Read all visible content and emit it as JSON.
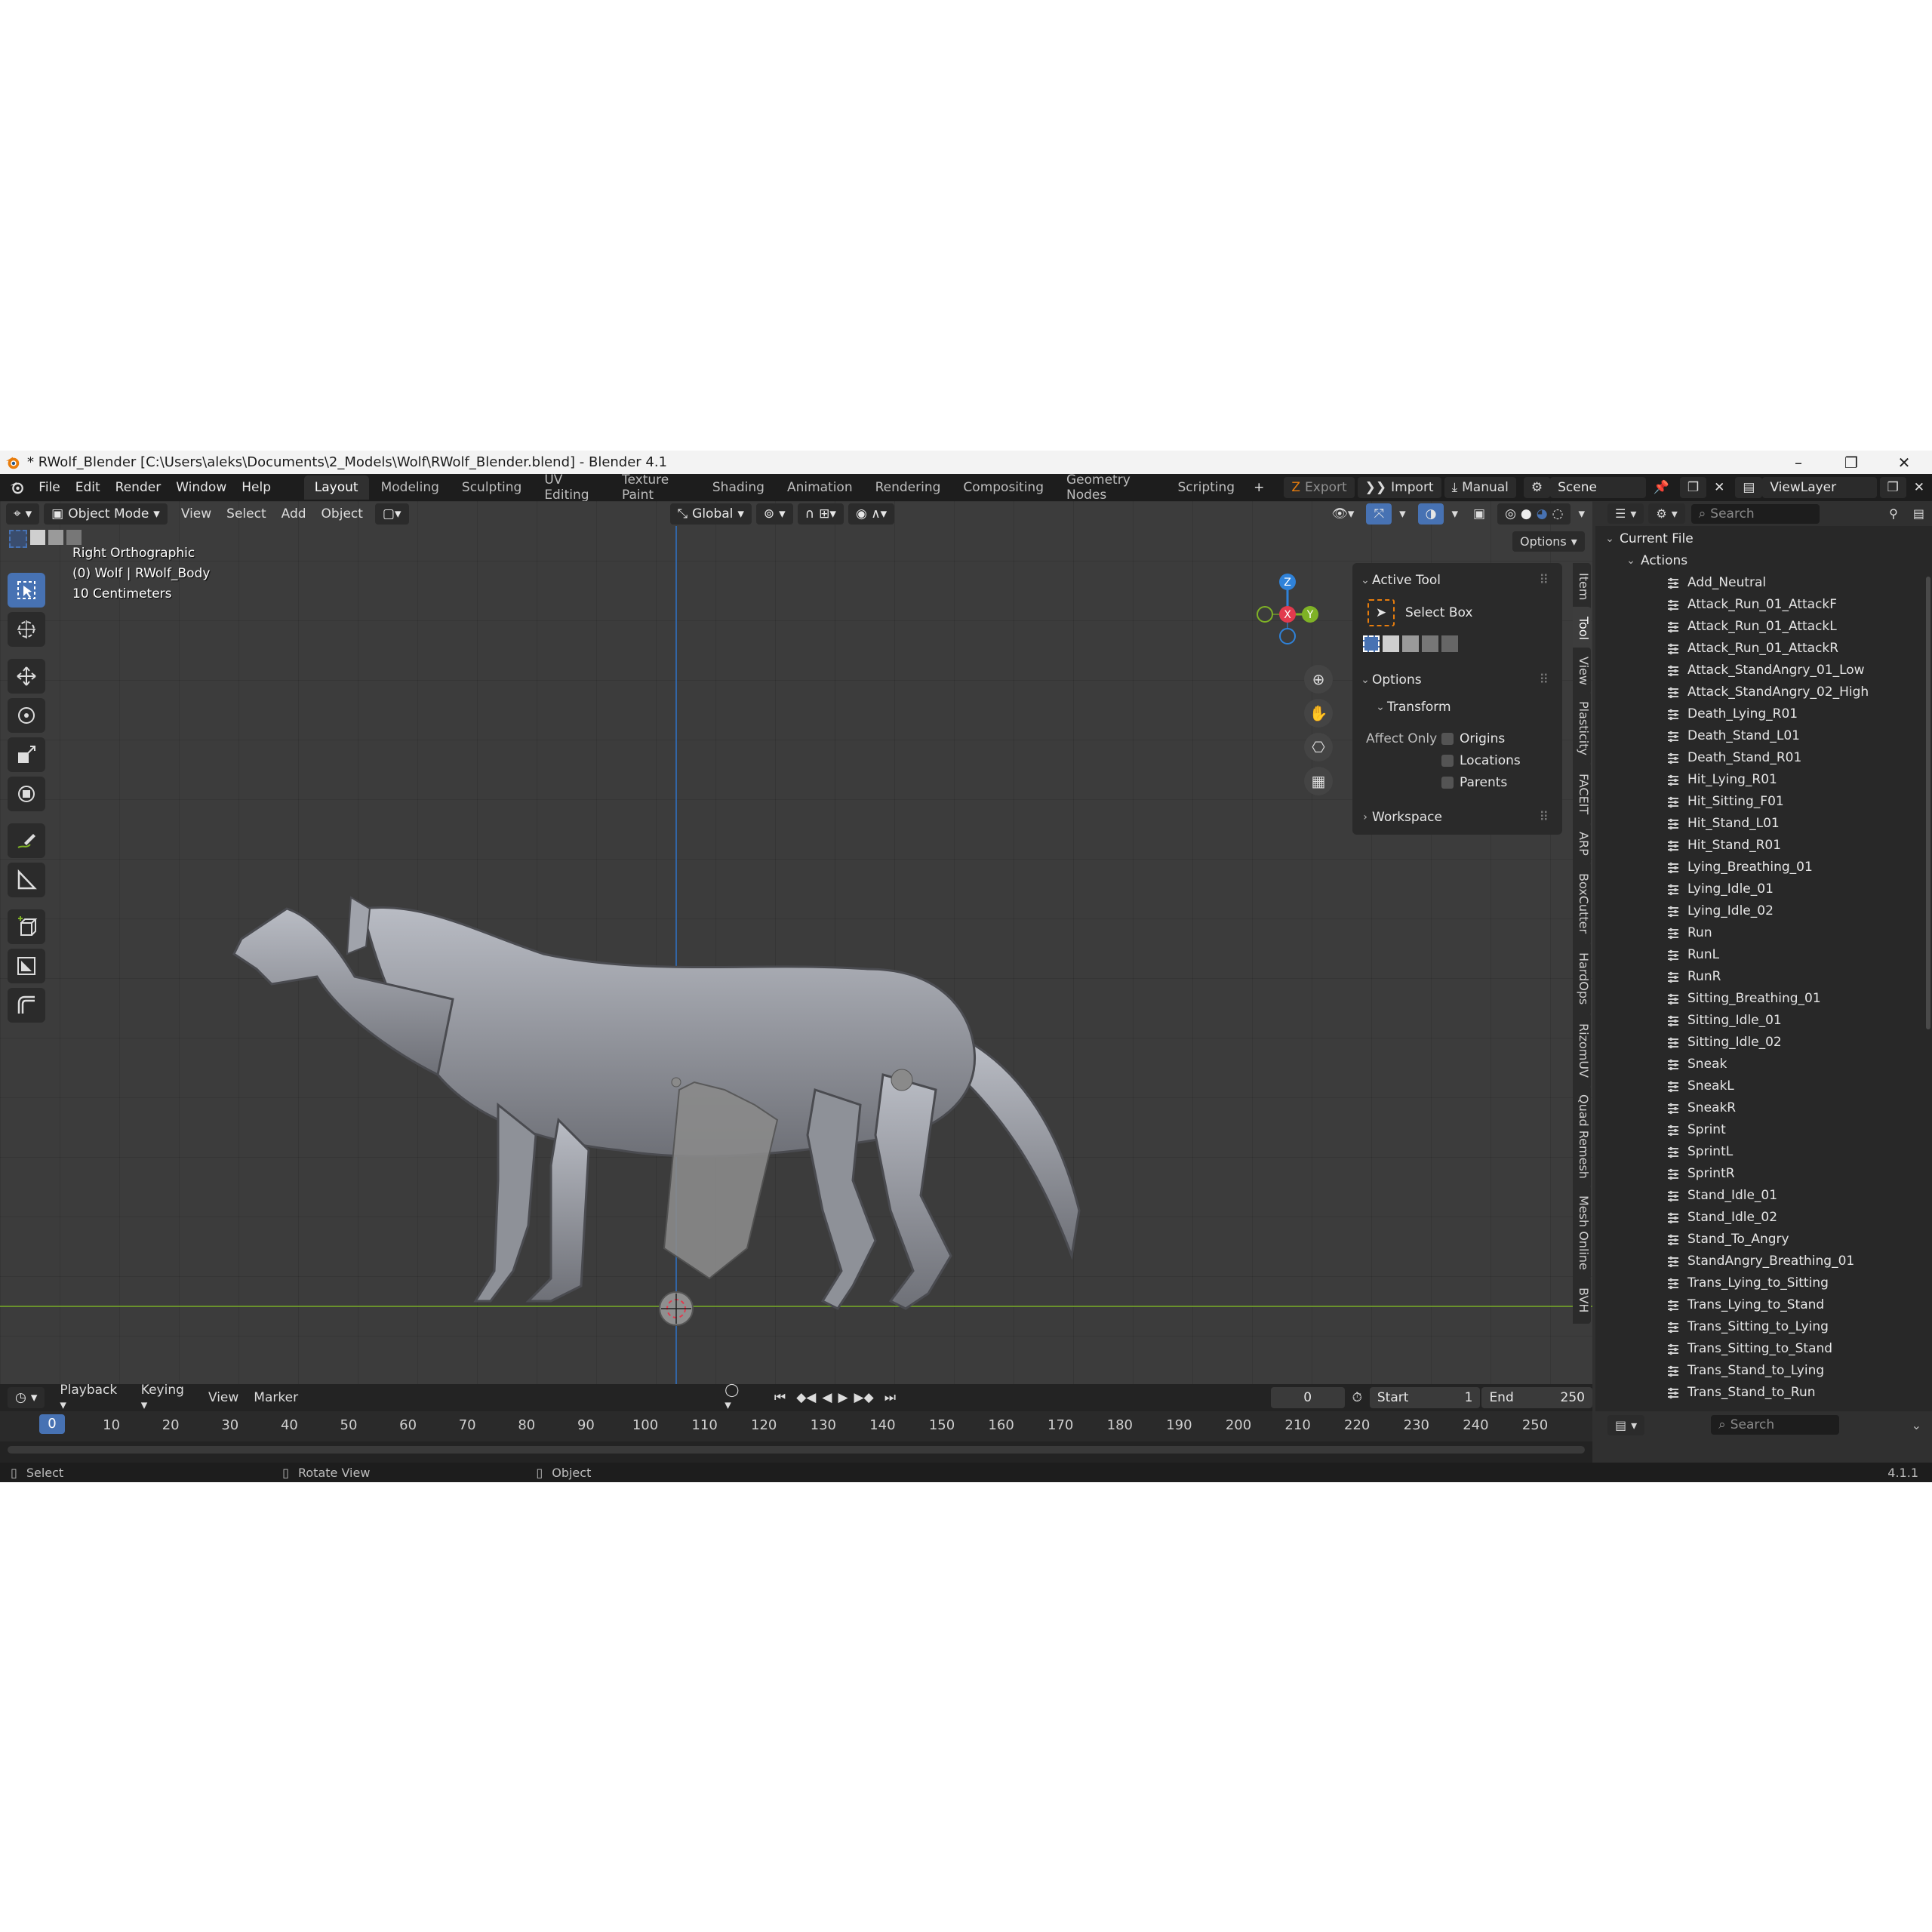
{
  "window": {
    "title": "* RWolf_Blender [C:\\Users\\aleks\\Documents\\2_Models\\Wolf\\RWolf_Blender.blend] - Blender 4.1",
    "minimize": "–",
    "maximize": "❐",
    "close": "✕"
  },
  "menu": [
    "File",
    "Edit",
    "Render",
    "Window",
    "Help"
  ],
  "workspaces": [
    "Layout",
    "Modeling",
    "Sculpting",
    "UV Editing",
    "Texture Paint",
    "Shading",
    "Animation",
    "Rendering",
    "Compositing",
    "Geometry Nodes",
    "Scripting"
  ],
  "addon_buttons": {
    "export": "Export",
    "import": "Import",
    "manual": "Manual"
  },
  "scene": "Scene",
  "view_layer": "ViewLayer",
  "viewport": {
    "mode": "Object Mode",
    "menus": [
      "View",
      "Select",
      "Add",
      "Object"
    ],
    "orientation": "Global",
    "options": "Options",
    "info": [
      "Right Orthographic",
      "(0) Wolf | RWolf_Body",
      "10 Centimeters"
    ],
    "gizmo": {
      "z": "Z",
      "x": "X",
      "y": "Y"
    }
  },
  "npanel": {
    "active_tool_header": "Active Tool",
    "tool_name": "Select Box",
    "options_header": "Options",
    "transform_header": "Transform",
    "affect_only": "Affect Only",
    "checkboxes": [
      "Origins",
      "Locations",
      "Parents"
    ],
    "workspace_header": "Workspace",
    "tabs": [
      "Item",
      "Tool",
      "View",
      "Plasticity",
      "FACEIT",
      "ARP",
      "BoxCutter",
      "HardOps",
      "RizomUV",
      "Quad Remesh",
      "Mesh Online",
      "BVH"
    ]
  },
  "timeline": {
    "menus": [
      "Playback",
      "Keying",
      "View",
      "Marker"
    ],
    "current_frame": "0",
    "start_label": "Start",
    "start": "1",
    "end_label": "End",
    "end": "250",
    "ticks": [
      "0",
      "10",
      "20",
      "30",
      "40",
      "50",
      "60",
      "70",
      "80",
      "90",
      "100",
      "110",
      "120",
      "130",
      "140",
      "150",
      "160",
      "170",
      "180",
      "190",
      "200",
      "210",
      "220",
      "230",
      "240",
      "250"
    ]
  },
  "statusbar": {
    "select": "Select",
    "rotate": "Rotate View",
    "object": "Object",
    "version": "4.1.1"
  },
  "outliner": {
    "search_placeholder": "Search",
    "current_file": "Current File",
    "actions_label": "Actions",
    "actions": [
      "Add_Neutral",
      "Attack_Run_01_AttackF",
      "Attack_Run_01_AttackL",
      "Attack_Run_01_AttackR",
      "Attack_StandAngry_01_Low",
      "Attack_StandAngry_02_High",
      "Death_Lying_R01",
      "Death_Stand_L01",
      "Death_Stand_R01",
      "Hit_Lying_R01",
      "Hit_Sitting_F01",
      "Hit_Stand_L01",
      "Hit_Stand_R01",
      "Lying_Breathing_01",
      "Lying_Idle_01",
      "Lying_Idle_02",
      "Run",
      "RunL",
      "RunR",
      "Sitting_Breathing_01",
      "Sitting_Idle_01",
      "Sitting_Idle_02",
      "Sneak",
      "SneakL",
      "SneakR",
      "Sprint",
      "SprintL",
      "SprintR",
      "Stand_Idle_01",
      "Stand_Idle_02",
      "Stand_To_Angry",
      "StandAngry_Breathing_01",
      "Trans_Lying_to_Sitting",
      "Trans_Lying_to_Stand",
      "Trans_Sitting_to_Lying",
      "Trans_Sitting_to_Stand",
      "Trans_Stand_to_Lying",
      "Trans_Stand_to_Run"
    ]
  },
  "properties": {
    "search_placeholder": "Search"
  },
  "colors": {
    "accent": "#4772b3",
    "x_axis": "#e23a4e",
    "y_axis": "#7fb226",
    "z_axis": "#2f82d9"
  }
}
